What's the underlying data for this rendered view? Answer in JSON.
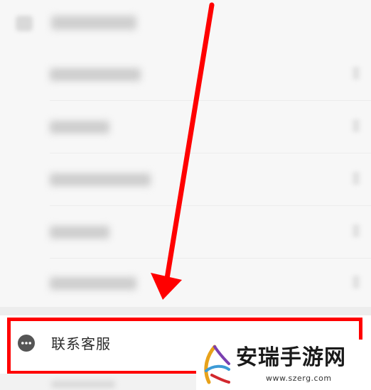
{
  "settings": {
    "contact_item": {
      "label": "联系客服",
      "icon": "chat-bubble-icon",
      "chevron": "›"
    }
  },
  "annotation": {
    "highlight_color": "#ff0000",
    "arrow_color": "#ff0000"
  },
  "watermark": {
    "name": "安瑞手游网",
    "url": "www.szerg.com"
  }
}
